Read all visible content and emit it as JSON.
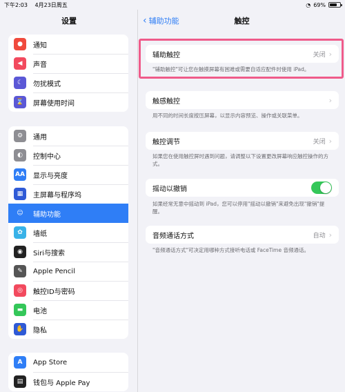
{
  "status": {
    "time": "下午2:03",
    "date": "4月23日周五",
    "battery": "69%",
    "battery_level": 0.69
  },
  "sidebar": {
    "title": "设置",
    "group1": [
      {
        "label": "通知",
        "icon": "bell-icon",
        "color": "#f04a3d"
      },
      {
        "label": "声音",
        "icon": "speaker-icon",
        "color": "#f24a5e"
      },
      {
        "label": "勿扰模式",
        "icon": "moon-icon",
        "color": "#5b58d6"
      },
      {
        "label": "屏幕使用时间",
        "icon": "hourglass-icon",
        "color": "#5b58d6"
      }
    ],
    "group2": [
      {
        "label": "通用",
        "icon": "gear-icon",
        "color": "#8e8e93"
      },
      {
        "label": "控制中心",
        "icon": "toggles-icon",
        "color": "#8e8e93"
      },
      {
        "label": "显示与亮度",
        "icon": "aa-icon",
        "color": "#2f7ef6"
      },
      {
        "label": "主屏幕与程序坞",
        "icon": "grid-icon",
        "color": "#2f5ad6"
      },
      {
        "label": "辅助功能",
        "icon": "accessibility-icon",
        "color": "#2f7ef6",
        "selected": true
      },
      {
        "label": "墙纸",
        "icon": "flower-icon",
        "color": "#38b2e8"
      },
      {
        "label": "Siri与搜索",
        "icon": "siri-icon",
        "color": "#222"
      },
      {
        "label": "Apple Pencil",
        "icon": "pencil-icon",
        "color": "#555"
      },
      {
        "label": "触控ID与密码",
        "icon": "fingerprint-icon",
        "color": "#f24a5e"
      },
      {
        "label": "电池",
        "icon": "battery-icon",
        "color": "#34c759"
      },
      {
        "label": "隐私",
        "icon": "hand-icon",
        "color": "#2f5ad6"
      }
    ],
    "group3": [
      {
        "label": "App Store",
        "icon": "appstore-icon",
        "color": "#2f7ef6"
      },
      {
        "label": "钱包与 Apple Pay",
        "icon": "wallet-icon",
        "color": "#222"
      }
    ]
  },
  "main": {
    "back": "辅助功能",
    "title": "触控",
    "rows": [
      {
        "label": "辅助触控",
        "value": "关闭",
        "desc": "\"辅助触控\"可让您在触摸屏幕有困难或需要自适应配件时使用 iPad。"
      },
      {
        "label": "触感触控",
        "value": "",
        "desc": "用不同的时间长度按压屏幕，以显示内容预览、操作或关联菜单。"
      },
      {
        "label": "触控调节",
        "value": "关闭",
        "desc": "如果您在使用触控屏时遇到问题，请调整以下设置更改屏幕响应触控操作的方式。"
      },
      {
        "label": "摇动以撤销",
        "toggle": true,
        "desc": "如果经常无意中摇动到 iPad，您可以停用\"摇动以撤销\"来避免出现\"撤销\"提醒。"
      },
      {
        "label": "音频通话方式",
        "value": "自动",
        "desc": "\"音频通话方式\"可决定用哪种方式接听电话或 FaceTime 音频通话。"
      }
    ]
  }
}
